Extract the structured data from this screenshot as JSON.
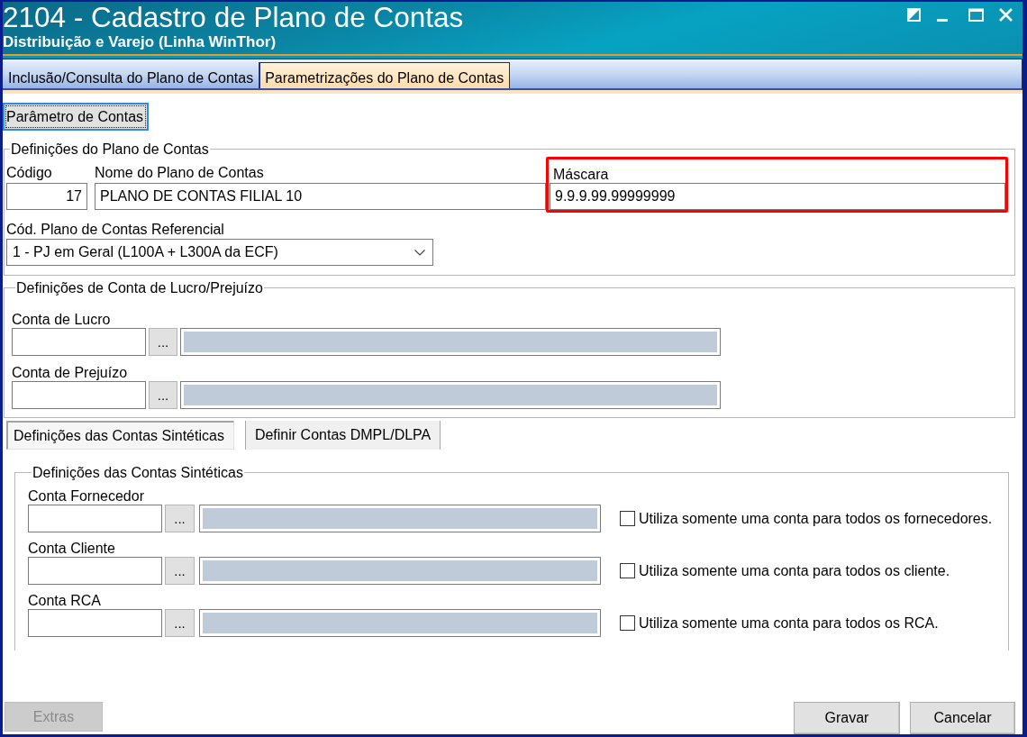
{
  "window": {
    "title": "2104 - Cadastro de Plano de Contas",
    "subtitle": "Distribuição e Varejo (Linha WinThor)"
  },
  "tabs": [
    {
      "label": "Inclusão/Consulta do Plano de Contas",
      "selected": false
    },
    {
      "label": "Parametrizações do Plano de Contas",
      "selected": true
    }
  ],
  "parameter_button": {
    "label": "Parâmetro de Contas"
  },
  "plan_group": {
    "title": "Definições do Plano de Contas",
    "fields": [
      {
        "label": "Código",
        "value": "17"
      },
      {
        "label": "Nome do Plano de Contas",
        "value": "PLANO DE CONTAS FILIAL 10"
      },
      {
        "label": "Máscara",
        "value": "9.9.9.99.99999999",
        "highlighted": true
      }
    ],
    "referential": {
      "label": "Cód. Plano de Contas Referencial",
      "value": "1 - PJ em Geral (L100A + L300A da ECF)"
    }
  },
  "profit_group": {
    "title": "Definições de Conta de Lucro/Prejuízo",
    "rows": [
      {
        "label": "Conta de Lucro",
        "button": "..."
      },
      {
        "label": "Conta de Prejuízo",
        "button": "..."
      }
    ]
  },
  "sub_tabs": [
    {
      "label": "Definições das Contas Sintéticas",
      "selected": true
    },
    {
      "label": "Definir Contas DMPL/DLPA",
      "selected": false
    }
  ],
  "synthetic_group": {
    "title": "Definições das Contas Sintéticas",
    "rows": [
      {
        "label": "Conta Fornecedor",
        "button": "...",
        "option": "Utiliza somente uma conta para todos os fornecedores.",
        "checked": false
      },
      {
        "label": "Conta Cliente",
        "button": "...",
        "option": "Utiliza somente uma conta para todos os cliente.",
        "checked": false
      },
      {
        "label": "Conta RCA",
        "button": "...",
        "option": "Utiliza somente uma conta para todos os RCA.",
        "checked": false
      }
    ]
  },
  "footer_buttons": [
    {
      "label": "Extras",
      "disabled": true
    },
    {
      "label": "Gravar",
      "disabled": false
    },
    {
      "label": "Cancelar",
      "disabled": false
    }
  ]
}
